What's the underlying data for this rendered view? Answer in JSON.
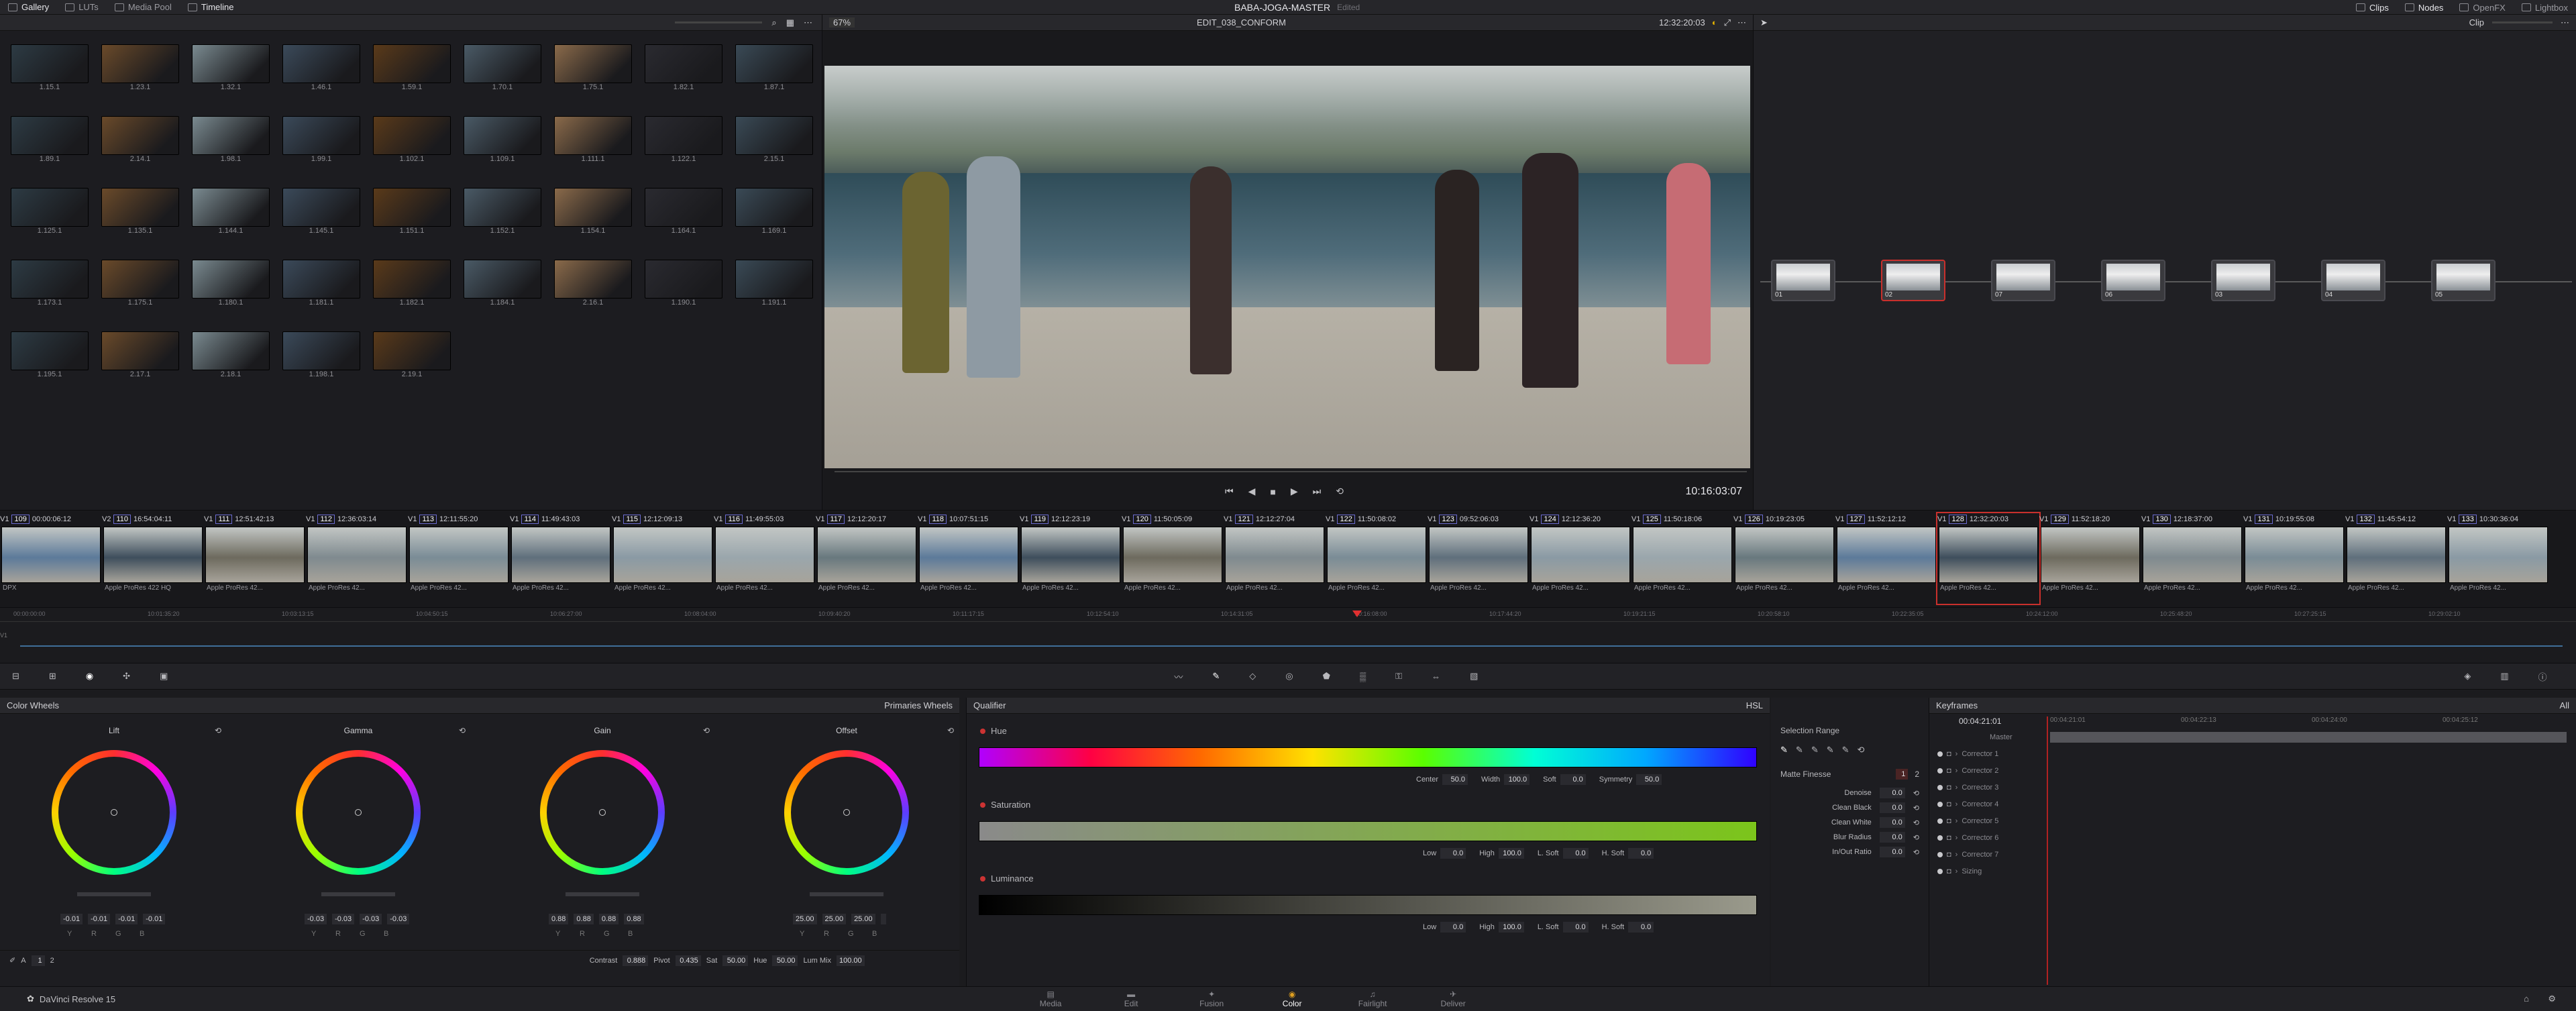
{
  "topbar": {
    "left_tabs": [
      "Gallery",
      "LUTs",
      "Media Pool",
      "Timeline"
    ],
    "project": "BABA-JOGA-MASTER",
    "edited": "Edited",
    "right_tabs": [
      "Clips",
      "Nodes",
      "OpenFX",
      "Lightbox"
    ]
  },
  "gallery": {
    "stills": [
      "1.15.1",
      "1.23.1",
      "1.32.1",
      "1.46.1",
      "1.59.1",
      "1.70.1",
      "1.75.1",
      "1.82.1",
      "1.87.1",
      "1.89.1",
      "2.14.1",
      "1.98.1",
      "1.99.1",
      "1.102.1",
      "1.109.1",
      "1.111.1",
      "1.122.1",
      "2.15.1",
      "1.125.1",
      "1.135.1",
      "1.144.1",
      "1.145.1",
      "1.151.1",
      "1.152.1",
      "1.154.1",
      "1.164.1",
      "1.169.1",
      "1.173.1",
      "1.175.1",
      "1.180.1",
      "1.181.1",
      "1.182.1",
      "1.184.1",
      "2.16.1",
      "1.190.1",
      "1.191.1",
      "1.195.1",
      "2.17.1",
      "2.18.1",
      "1.198.1",
      "2.19.1"
    ]
  },
  "viewer": {
    "zoom": "67%",
    "timeline_name": "EDIT_038_CONFORM",
    "timecode_top": "12:32:20:03",
    "timecode": "10:16:03:07"
  },
  "nodes": {
    "mode": "Clip",
    "items": [
      "01",
      "02",
      "07",
      "06",
      "03",
      "04",
      "05"
    ]
  },
  "timeline": {
    "clips": [
      {
        "v": "V1",
        "n": "109",
        "tc": "00:00:06:12",
        "codec": "DPX"
      },
      {
        "v": "V2",
        "n": "110",
        "tc": "16:54:04:11",
        "codec": "Apple ProRes 422 HQ"
      },
      {
        "v": "V1",
        "n": "111",
        "tc": "12:51:42:13",
        "codec": "Apple ProRes 42..."
      },
      {
        "v": "V1",
        "n": "112",
        "tc": "12:36:03:14",
        "codec": "Apple ProRes 42..."
      },
      {
        "v": "V1",
        "n": "113",
        "tc": "12:11:55:20",
        "codec": "Apple ProRes 42..."
      },
      {
        "v": "V1",
        "n": "114",
        "tc": "11:49:43:03",
        "codec": "Apple ProRes 42..."
      },
      {
        "v": "V1",
        "n": "115",
        "tc": "12:12:09:13",
        "codec": "Apple ProRes 42..."
      },
      {
        "v": "V1",
        "n": "116",
        "tc": "11:49:55:03",
        "codec": "Apple ProRes 42..."
      },
      {
        "v": "V1",
        "n": "117",
        "tc": "12:12:20:17",
        "codec": "Apple ProRes 42..."
      },
      {
        "v": "V1",
        "n": "118",
        "tc": "10:07:51:15",
        "codec": "Apple ProRes 42..."
      },
      {
        "v": "V1",
        "n": "119",
        "tc": "12:12:23:19",
        "codec": "Apple ProRes 42..."
      },
      {
        "v": "V1",
        "n": "120",
        "tc": "11:50:05:09",
        "codec": "Apple ProRes 42..."
      },
      {
        "v": "V1",
        "n": "121",
        "tc": "12:12:27:04",
        "codec": "Apple ProRes 42..."
      },
      {
        "v": "V1",
        "n": "122",
        "tc": "11:50:08:02",
        "codec": "Apple ProRes 42..."
      },
      {
        "v": "V1",
        "n": "123",
        "tc": "09:52:06:03",
        "codec": "Apple ProRes 42..."
      },
      {
        "v": "V1",
        "n": "124",
        "tc": "12:12:36:20",
        "codec": "Apple ProRes 42..."
      },
      {
        "v": "V1",
        "n": "125",
        "tc": "11:50:18:06",
        "codec": "Apple ProRes 42..."
      },
      {
        "v": "V1",
        "n": "126",
        "tc": "10:19:23:05",
        "codec": "Apple ProRes 42..."
      },
      {
        "v": "V1",
        "n": "127",
        "tc": "11:52:12:12",
        "codec": "Apple ProRes 42..."
      },
      {
        "v": "V1",
        "n": "128",
        "tc": "12:32:20:03",
        "codec": "Apple ProRes 42..."
      },
      {
        "v": "V1",
        "n": "129",
        "tc": "11:52:18:20",
        "codec": "Apple ProRes 42..."
      },
      {
        "v": "V1",
        "n": "130",
        "tc": "12:18:37:00",
        "codec": "Apple ProRes 42..."
      },
      {
        "v": "V1",
        "n": "131",
        "tc": "10:19:55:08",
        "codec": "Apple ProRes 42..."
      },
      {
        "v": "V1",
        "n": "132",
        "tc": "11:45:54:12",
        "codec": "Apple ProRes 42..."
      },
      {
        "v": "V1",
        "n": "133",
        "tc": "10:30:36:04",
        "codec": "Apple ProRes 42..."
      }
    ],
    "ruler": [
      "00:00:00:00",
      "10:01:35:20",
      "10:03:13:15",
      "10:04:50:15",
      "10:06:27:00",
      "10:08:04:00",
      "10:09:40:20",
      "10:11:17:15",
      "10:12:54:10",
      "10:14:31:05",
      "10:16:08:00",
      "10:17:44:20",
      "10:19:21:15",
      "10:20:58:10",
      "10:22:35:05",
      "10:24:12:00",
      "10:25:48:20",
      "10:27:25:15",
      "10:29:02:10"
    ]
  },
  "color_wheels": {
    "title": "Color Wheels",
    "mode": "Primaries Wheels",
    "wheels": [
      {
        "name": "Lift",
        "vals": [
          "-0.01",
          "-0.01",
          "-0.01",
          "-0.01"
        ]
      },
      {
        "name": "Gamma",
        "vals": [
          "-0.03",
          "-0.03",
          "-0.03",
          "-0.03"
        ]
      },
      {
        "name": "Gain",
        "vals": [
          "0.88",
          "0.88",
          "0.88",
          "0.88"
        ]
      },
      {
        "name": "Offset",
        "vals": [
          "25.00",
          "25.00",
          "25.00",
          ""
        ]
      }
    ],
    "channels": [
      "Y",
      "R",
      "G",
      "B"
    ],
    "pages": [
      "1",
      "2"
    ],
    "contrast_label": "Contrast",
    "contrast": "0.888",
    "pivot_label": "Pivot",
    "pivot": "0.435",
    "sat_label": "Sat",
    "sat": "50.00",
    "hue_label": "Hue",
    "hue": "50.00",
    "lummix_label": "Lum Mix",
    "lummix": "100.00"
  },
  "qualifier": {
    "title": "Qualifier",
    "mode": "HSL",
    "hue": "Hue",
    "center_label": "Center",
    "center": "50.0",
    "width_label": "Width",
    "width": "100.0",
    "soft_label": "Soft",
    "soft": "0.0",
    "sym_label": "Symmetry",
    "sym": "50.0",
    "saturation": "Saturation",
    "luminance": "Luminance",
    "low_label": "Low",
    "low": "0.0",
    "high_label": "High",
    "high": "100.0",
    "lsoft_label": "L. Soft",
    "lsoft": "0.0",
    "hsoft_label": "H. Soft",
    "hsoft": "0.0"
  },
  "selection": {
    "title": "Selection Range",
    "matte": "Matte Finesse",
    "matte_page": "1",
    "matte_page2": "2",
    "fields": [
      {
        "label": "Denoise",
        "v": "0.0"
      },
      {
        "label": "Clean Black",
        "v": "0.0"
      },
      {
        "label": "Clean White",
        "v": "0.0"
      },
      {
        "label": "Blur Radius",
        "v": "0.0"
      },
      {
        "label": "In/Out Ratio",
        "v": "0.0"
      }
    ]
  },
  "keyframes": {
    "title": "Keyframes",
    "filter": "All",
    "tc": "00:04:21:01",
    "ruler": [
      "00:04:21:01",
      "00:04:22:13",
      "00:04:24:00",
      "00:04:25:12"
    ],
    "tracks": [
      "Master",
      "Corrector 1",
      "Corrector 2",
      "Corrector 3",
      "Corrector 4",
      "Corrector 5",
      "Corrector 6",
      "Corrector 7",
      "Sizing"
    ]
  },
  "footer": {
    "app": "DaVinci Resolve 15",
    "pages": [
      "Media",
      "Edit",
      "Fusion",
      "Color",
      "Fairlight",
      "Deliver"
    ],
    "active": "Color"
  }
}
